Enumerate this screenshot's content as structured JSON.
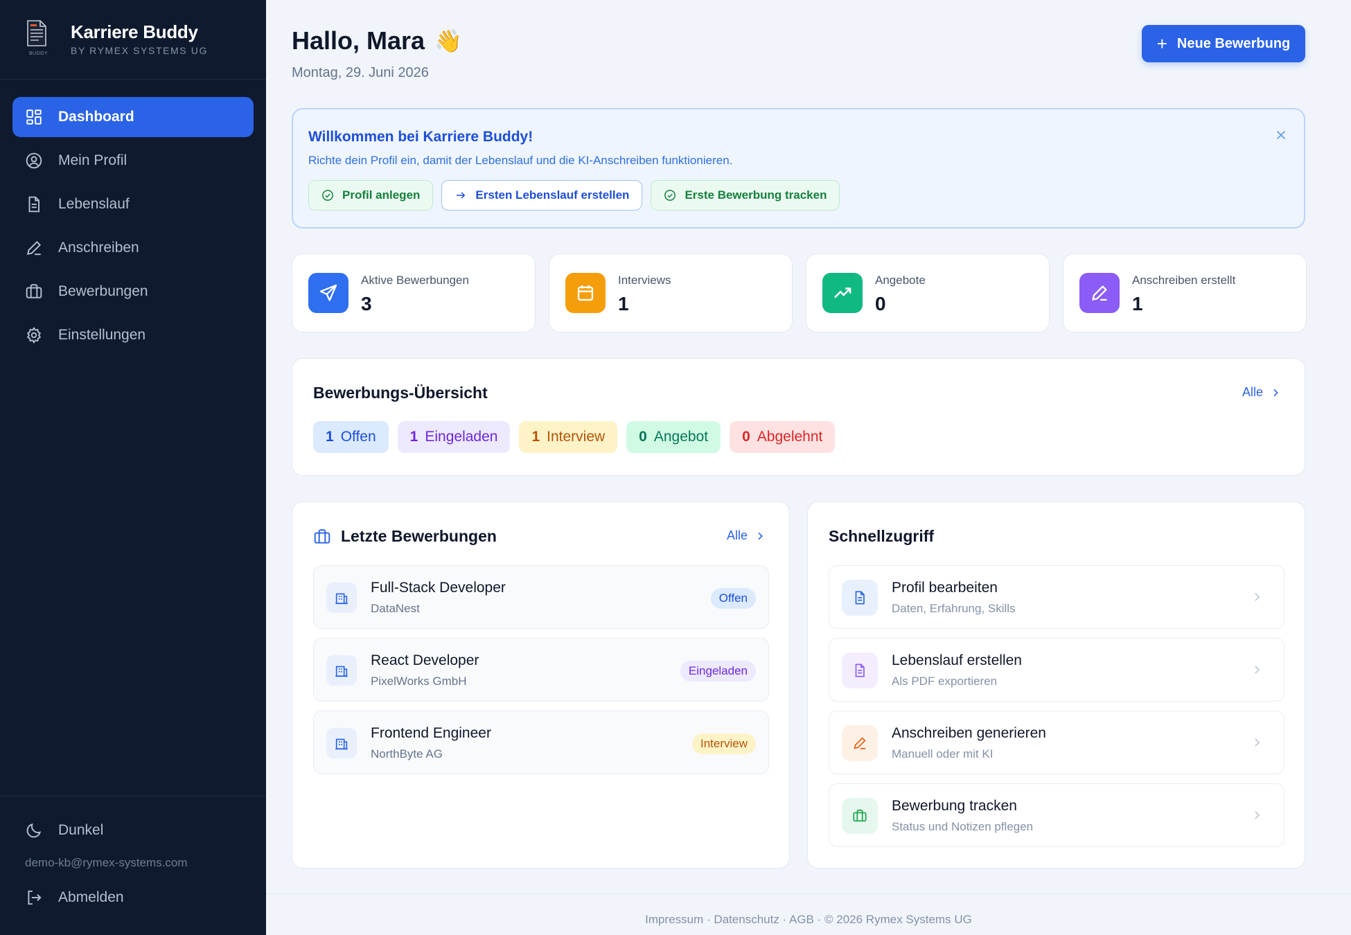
{
  "brand": {
    "title": "Karriere Buddy",
    "subtitle": "BY RYMEX SYSTEMS UG",
    "logo_text": "BUDDY"
  },
  "sidebar": {
    "items": [
      {
        "label": "Dashboard",
        "icon": "dashboard-icon",
        "active": true
      },
      {
        "label": "Mein Profil",
        "icon": "user-circle-icon"
      },
      {
        "label": "Lebenslauf",
        "icon": "document-icon"
      },
      {
        "label": "Anschreiben",
        "icon": "pen-icon"
      },
      {
        "label": "Bewerbungen",
        "icon": "briefcase-icon"
      },
      {
        "label": "Einstellungen",
        "icon": "gear-icon"
      }
    ],
    "theme_label": "Dunkel",
    "email": "demo-kb@rymex-systems.com",
    "logout_label": "Abmelden"
  },
  "header": {
    "greeting": "Hallo, Mara",
    "wave": "👋",
    "date": "Montag, 29. Juni 2026",
    "new_button": "Neue Bewerbung"
  },
  "welcome": {
    "title": "Willkommen bei Karriere Buddy!",
    "text": "Richte dein Profil ein, damit der Lebenslauf und die KI-Anschreiben funktionieren.",
    "chips": [
      "Profil anlegen",
      "Ersten Lebenslauf erstellen",
      "Erste Bewerbung tracken"
    ]
  },
  "stats": [
    {
      "label": "Aktive Bewerbungen",
      "value": "3",
      "color": "#2f6ff0"
    },
    {
      "label": "Interviews",
      "value": "1",
      "color": "#f59e0b"
    },
    {
      "label": "Angebote",
      "value": "0",
      "color": "#10b981"
    },
    {
      "label": "Anschreiben erstellt",
      "value": "1",
      "color": "#8b5cf6"
    }
  ],
  "overview": {
    "title": "Bewerbungs-Übersicht",
    "all_label": "Alle",
    "statuses": [
      {
        "count": "1",
        "label": "Offen"
      },
      {
        "count": "1",
        "label": "Eingeladen"
      },
      {
        "count": "1",
        "label": "Interview"
      },
      {
        "count": "0",
        "label": "Angebot"
      },
      {
        "count": "0",
        "label": "Abgelehnt"
      }
    ]
  },
  "recent": {
    "title": "Letzte Bewerbungen",
    "all_label": "Alle",
    "items": [
      {
        "title": "Full-Stack Developer",
        "company": "DataNest",
        "status": "Offen"
      },
      {
        "title": "React Developer",
        "company": "PixelWorks GmbH",
        "status": "Eingeladen"
      },
      {
        "title": "Frontend Engineer",
        "company": "NorthByte AG",
        "status": "Interview"
      }
    ]
  },
  "quick": {
    "title": "Schnellzugriff",
    "items": [
      {
        "title": "Profil bearbeiten",
        "subtitle": "Daten, Erfahrung, Skills"
      },
      {
        "title": "Lebenslauf erstellen",
        "subtitle": "Als PDF exportieren"
      },
      {
        "title": "Anschreiben generieren",
        "subtitle": "Manuell oder mit KI"
      },
      {
        "title": "Bewerbung tracken",
        "subtitle": "Status und Notizen pflegen"
      }
    ]
  },
  "footer": {
    "text": "Impressum · Datenschutz · AGB · © 2026 Rymex Systems UG"
  }
}
